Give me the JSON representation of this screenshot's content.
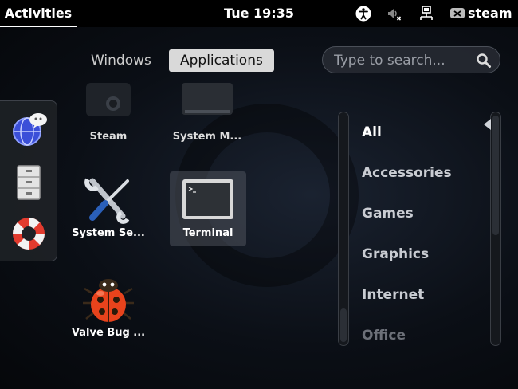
{
  "topbar": {
    "activities_label": "Activities",
    "clock": "Tue 19:35",
    "user": "steam",
    "tray_icons": [
      "accessibility-icon",
      "volume-muted-icon",
      "network-wired-icon",
      "user-status-icon"
    ]
  },
  "view_switch": {
    "windows_label": "Windows",
    "applications_label": "Applications",
    "active": "Applications"
  },
  "search": {
    "placeholder": "Type to search..."
  },
  "dash": {
    "items": [
      {
        "name": "messaging",
        "icon": "empathy-icon"
      },
      {
        "name": "files",
        "icon": "file-cabinet-icon"
      },
      {
        "name": "help",
        "icon": "lifebuoy-icon"
      }
    ]
  },
  "apps": [
    {
      "label": "Steam",
      "icon": "steam-icon"
    },
    {
      "label": "System M...",
      "icon": "system-monitor-icon"
    },
    {
      "label": "System Se...",
      "icon": "tools-icon"
    },
    {
      "label": "Terminal",
      "icon": "terminal-icon",
      "selected": true
    },
    {
      "label": "Valve Bug ...",
      "icon": "bug-icon"
    }
  ],
  "categories": [
    "All",
    "Accessories",
    "Games",
    "Graphics",
    "Internet",
    "Office"
  ],
  "active_category": "All",
  "colors": {
    "topbar_bg": "#000000",
    "active_switch_bg": "#d9d9d9",
    "selected_app_bg": "#5a5f69"
  }
}
